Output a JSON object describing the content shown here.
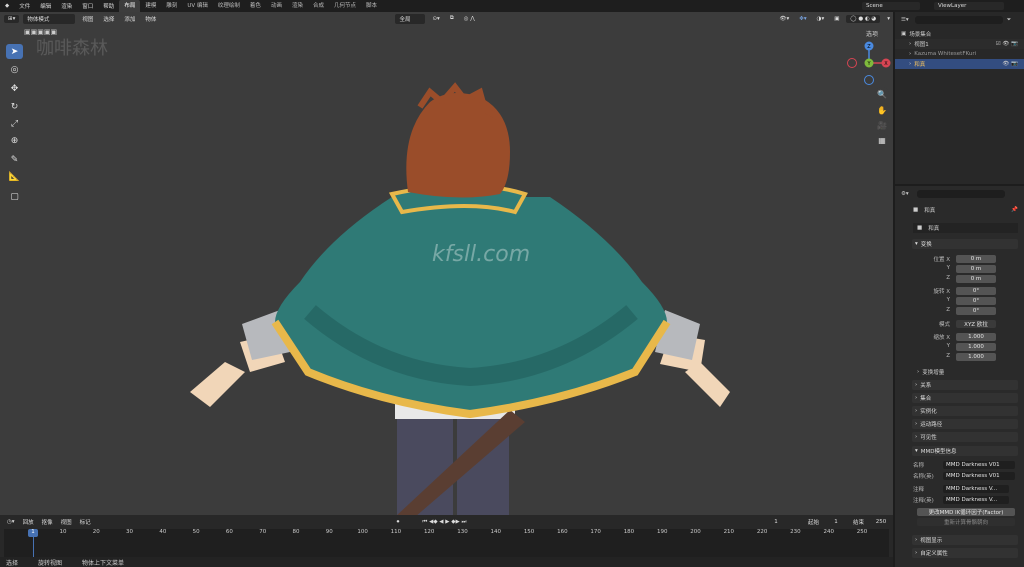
{
  "menu": [
    "文件",
    "编辑",
    "渲染",
    "窗口",
    "帮助"
  ],
  "workspaces": [
    "布局",
    "建模",
    "雕刻",
    "UV 编辑",
    "纹理绘制",
    "着色",
    "动画",
    "渲染",
    "合成",
    "几何节点",
    "脚本"
  ],
  "active_workspace": "布局",
  "scene_name": "Scene",
  "view_layer": "ViewLayer",
  "viewport": {
    "mode": "物体模式",
    "menus": [
      "视图",
      "选择",
      "添加",
      "物体"
    ],
    "orientation": "全局",
    "options_label": "选项",
    "watermark_text": "咖啡森林",
    "center_watermark": "kfsll.com",
    "axis_labels": {
      "x": "X",
      "y": "Y",
      "z": "Z"
    }
  },
  "outliner": {
    "collection": "场景集合",
    "items": [
      "视图1",
      "Kazuma WhitesetFKuri",
      "和真"
    ]
  },
  "properties": {
    "object_name": "和真",
    "data_name": "和真",
    "transform_label": "变换",
    "location_label": "位置 X",
    "location": [
      "0 m",
      "0 m",
      "0 m"
    ],
    "rotation_label": "旋转 X",
    "rotation": [
      "0°",
      "0°",
      "0°"
    ],
    "mode_label": "模式",
    "mode_value": "XYZ 欧拉",
    "scale_label": "缩放 X",
    "scale": [
      "1.000",
      "1.000",
      "1.000"
    ],
    "delta_label": "变换增量",
    "sections": [
      "关系",
      "集合",
      "实例化",
      "运动路径",
      "可见性"
    ],
    "mmd_panel": "MMD模型信息",
    "mmd_name_label": "名称",
    "mmd_name": "MMD Darkness V01",
    "mmd_name_en_label": "名称(英)",
    "mmd_name_en": "MMD Darkness V01",
    "comment_label": "注释",
    "comment": "MMD Darkness V...",
    "comment_en_label": "注释(英)",
    "comment_en": "MMD Darkness V...",
    "morph_button": "更改MMD IK循环因子(Factor)",
    "recalc_button": "重新计算骨骼朝向",
    "bottom_sections": [
      "视图显示",
      "自定义属性"
    ]
  },
  "timeline": {
    "menus": [
      "回放",
      "抠像",
      "视图",
      "标记"
    ],
    "current_frame": "1",
    "start_label": "起始",
    "start": "1",
    "end_label": "结束",
    "end": "250",
    "ticks": [
      "1",
      "10",
      "20",
      "30",
      "40",
      "50",
      "60",
      "70",
      "80",
      "90",
      "100",
      "110",
      "120",
      "130",
      "140",
      "150",
      "160",
      "170",
      "180",
      "190",
      "200",
      "210",
      "220",
      "230",
      "240",
      "250"
    ]
  },
  "status": [
    "选择",
    "旋转视图",
    "物体上下文菜单"
  ]
}
